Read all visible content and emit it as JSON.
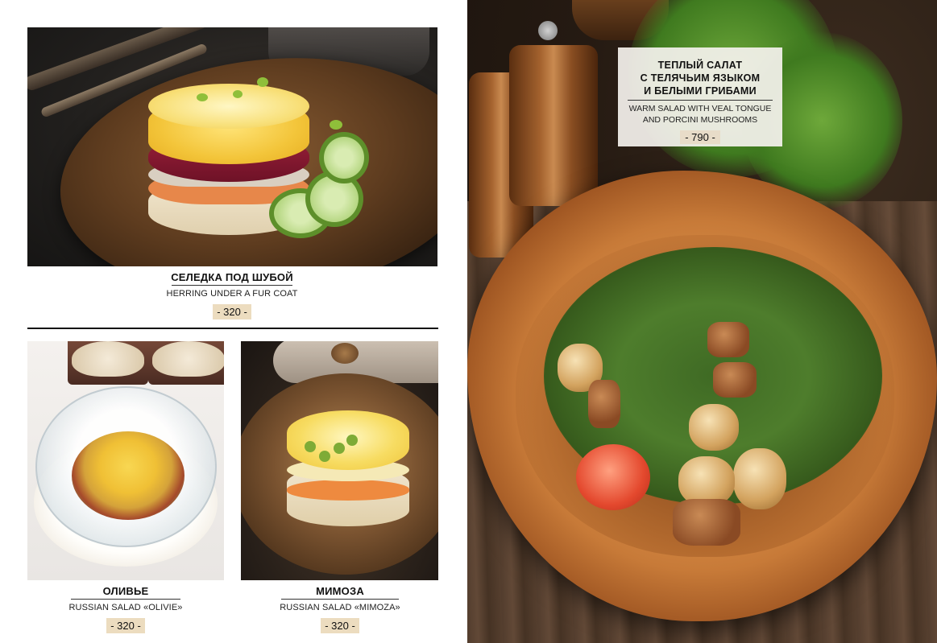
{
  "dishes": {
    "herring": {
      "name_ru": "СЕЛЕДКА ПОД ШУБОЙ",
      "name_en": "HERRING UNDER A FUR COAT",
      "price": "- 320 -"
    },
    "olivie": {
      "name_ru": "ОЛИВЬЕ",
      "name_en": "RUSSIAN SALAD «OLIVIE»",
      "price": "- 320 -"
    },
    "mimoza": {
      "name_ru": "МИМОЗА",
      "name_en": "RUSSIAN SALAD «MIMOZA»",
      "price": "- 320 -"
    },
    "warm_salad": {
      "name_ru_line1": "ТЕПЛЫЙ САЛАТ",
      "name_ru_line2": "С ТЕЛЯЧЬИМ ЯЗЫКОМ",
      "name_ru_line3": "И БЕЛЫМИ ГРИБАМИ",
      "name_en_line1": "WARM SALAD WITH VEAL TONGUE",
      "name_en_line2": "AND PORCINI MUSHROOMS",
      "price": "- 790 -"
    }
  },
  "colors": {
    "price_bg": "#ecdcbf",
    "text": "#111111"
  }
}
